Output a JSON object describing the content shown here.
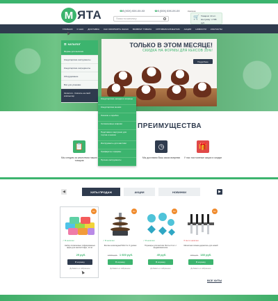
{
  "header": {
    "logo_letter": "М",
    "logo_text": "ЯТА",
    "phone1": "8 (XXX) XXX-XX-XX",
    "phone2": "8 (XXX) XXX-XX-XX",
    "search_placeholder": "Поиск по каталогу",
    "cart": {
      "title": "Корзина",
      "line1": "Товаров: 10 шт.",
      "line2": "На сумму: 4 788 руб."
    }
  },
  "nav": [
    "ГЛАВНАЯ",
    "О НАС",
    "ДОСТАВКА",
    "КАК ОФОРМИТЬ ЗАКАЗ",
    "ВОЗВРАТ ТОВАРА",
    "ОПТОВЫМ КЛИЕНТАМ",
    "АКЦИИ",
    "НОВОСТИ",
    "КОНТАКТЫ"
  ],
  "catalog": {
    "title": "КАТАЛОГ",
    "items": [
      "Формы для выпечки",
      "Кондитерские инструменты",
      "Кондитерские ингредиенты",
      "Оборудование",
      "Всё для упаковки"
    ],
    "highlight": "Каталоги - Скачать на свой компьютер"
  },
  "submenu": [
    "Кондитерские насадки и шприцы",
    "Кондитерские мешки",
    "Лопатки и скребки",
    "Силиконовые коврики",
    "Подставки и вертушки для тортов и кексов",
    "Инструменты для мастики",
    "Трафареты и формы",
    "Прочие инструменты"
  ],
  "promo": {
    "title": "ТОЛЬКО В ЭТОМ МЕСЯЦЕ!",
    "subtitle": "СКИДКА НА ФОРМЫ ДЛЯ КЕКСОВ 35%!",
    "button": "Подробнее"
  },
  "benefits": {
    "title": "ПРЕИМУЩЕСТВА",
    "items": [
      {
        "text": "Мы следим за качеством наших товаров",
        "icon": "clipboard-icon",
        "color": "#3cb46e"
      },
      {
        "text": "Мы доставим Ваш заказ вовремя",
        "icon": "clock-icon",
        "color": "#2f3b4e"
      },
      {
        "text": "У нас постоянные акции и скидки",
        "icon": "gift-icon",
        "color": "#e04848"
      }
    ]
  },
  "tabs": {
    "hits": "ХИТЫ ПРОДАЖ",
    "sale": "АКЦИИ",
    "new": "НОВИНКИ"
  },
  "products": [
    {
      "badge": "Хит",
      "stock": "✓ В наличии",
      "name": "Набор силиконовых гофрированных форм для кексов Гофре, 12 шт.",
      "old_price": "",
      "price": "29 руб.",
      "button": "В корзину",
      "fav": "Добавить в избранное"
    },
    {
      "badge": "Хит",
      "stock": "✓ В наличии",
      "name": "Фонтан шоколадный Mini 6 кг 3 уровня",
      "old_price": "2 500 руб.",
      "price": "1 600 руб.",
      "button": "В корзину",
      "fav": "Добавить в избранное"
    },
    {
      "badge": "Хит",
      "stock": "✓ В наличии",
      "name": "Плунжеры для мастики Листья 3 шт. с выдавливателем",
      "old_price": "",
      "price": "49 руб.",
      "button": "В корзину",
      "fav": "Добавить в избранное"
    },
    {
      "badge": "Хит",
      "stock": "✕ Нет в наличии",
      "name": "Магнитная планка держатель для ножей",
      "old_price": "220 руб.",
      "price": "180 руб.",
      "button": "В корзину",
      "fav": "Добавить в избранное"
    }
  ],
  "all_hits": "ВСЕ ХИТЫ",
  "colors": {
    "accent": "#3cb46e",
    "dark": "#2f3b4e",
    "badge": "#f08a2b"
  }
}
